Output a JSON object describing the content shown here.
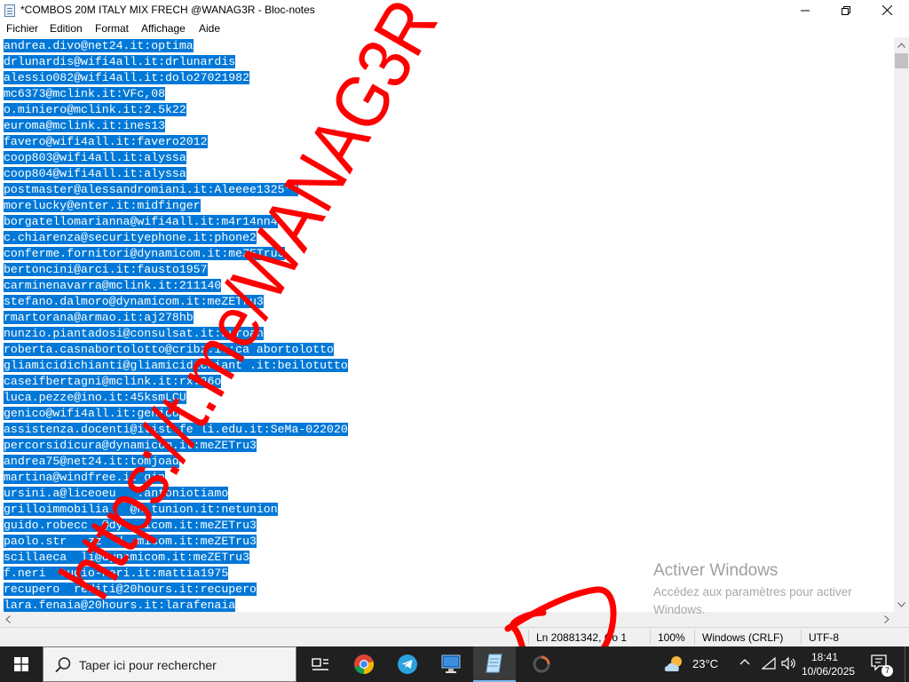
{
  "window": {
    "title": "*COMBOS 20M ITALY MIX FRECH @WANAG3R - Bloc-notes"
  },
  "menu": {
    "items": [
      "Fichier",
      "Edition",
      "Format",
      "Affichage",
      "Aide"
    ]
  },
  "editor": {
    "selection_color": "#0078d7",
    "lines": [
      "andrea.divo@net24.it:optima",
      "drlunardis@wifi4all.it:drlunardis",
      "alessio082@wifi4all.it:dolo27021982",
      "mc6373@mclink.it:VFc,08",
      "o.miniero@mclink.it:2.5k22",
      "euroma@mclink.it:ines13",
      "favero@wifi4all.it:favero2012",
      "coop803@wifi4all.it:alyssa",
      "coop804@wifi4all.it:alyssa",
      "postmaster@alessandromiani.it:Aleeee1325**",
      "morelucky@enter.it:midfinger",
      "borgatellomarianna@wifi4all.it:m4r14nn4",
      "c.chiarenza@securityephone.it:phone2",
      "conferme.fornitori@dynamicom.it:meZETru3",
      "bertoncini@arci.it:fausto1957",
      "carminenavarra@mclink.it:211140",
      "stefano.dalmoro@dynamicom.it:meZETru3",
      "rmartorana@armao.it:aj278hb",
      "nunzio.piantadosi@consulsat.it:nuroan",
      "roberta.casnabortolotto@cribz.it:ca abortolotto",
      "gliamicidichianti@gliamicidichiant .it:beilotutto",
      "caseifbertagni@mclink.it:rx.26o",
      "luca.pezze@ino.it:45ksmLCU",
      "genico@wifi4all.it:genico",
      "assistenza.docenti@itist fe li.edu.it:SeMa-022020",
      "percorsidicura@dynamicom.it:meZETru3",
      "andrea75@net24.it:tomjoad",
      "martina@windfree.it gin",
      "ursini.a@liceoeu   :antoniotiamo",
      "grilloimmobilia   @n tunion.it:netunion",
      "guido.robecc  @dy   icom.it:meZETru3",
      "paolo.str   zz  d  micom.it:meZETru3",
      "scillaeca  li@dynamicom.it:meZETru3",
      "f.neri  tudio-neri.it:mattia1975",
      "recupero  rediti@20hours.it:recupero",
      "lara.fenaia@20hours.it:larafenaia"
    ]
  },
  "status": {
    "position": "Ln 20881342, Co  1",
    "zoom": "100%",
    "line_ending": "Windows (CRLF)",
    "encoding": "UTF-8"
  },
  "activation": {
    "title": "Activer Windows",
    "subtitle": "Accédez aux paramètres pour activer Windows."
  },
  "overlay": {
    "text": "https://t.me/WANAG3R",
    "color": "#ff0000"
  },
  "taskbar": {
    "search_placeholder": "Taper ici pour rechercher",
    "apps": [
      "task-view-icon",
      "chrome-icon",
      "telegram-icon",
      "remote-desktop-icon",
      "notepad-icon",
      "loading-icon"
    ],
    "weather_temp": "23°C",
    "time": "18:41",
    "date": "10/06/2025",
    "notification_count": "7"
  }
}
